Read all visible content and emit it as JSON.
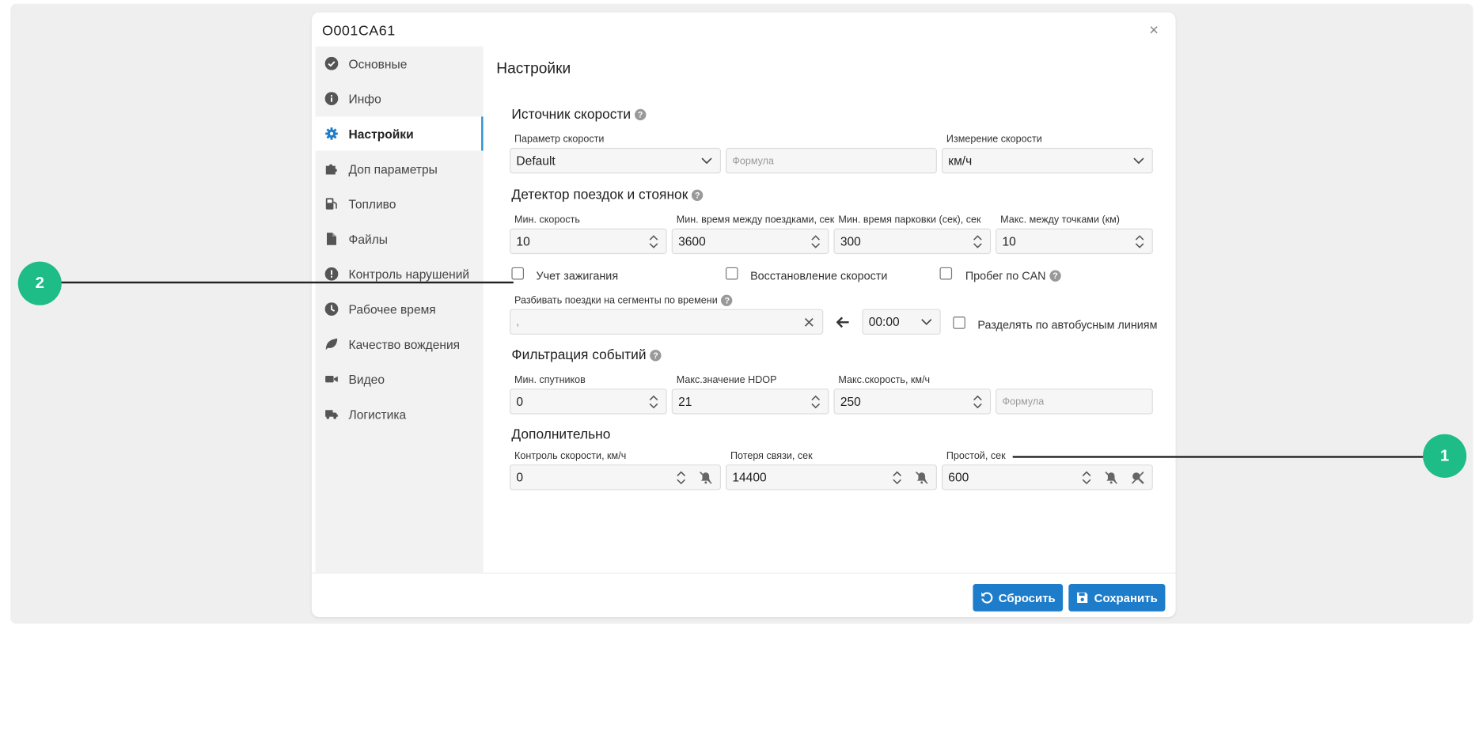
{
  "window": {
    "title": "O001CA61",
    "close": "×"
  },
  "sidebar": {
    "items": [
      {
        "label": "Основные",
        "icon": "check-circle-icon"
      },
      {
        "label": "Инфо",
        "icon": "info-icon"
      },
      {
        "label": "Настройки",
        "icon": "gear-icon",
        "active": true
      },
      {
        "label": "Доп параметры",
        "icon": "puzzle-icon"
      },
      {
        "label": "Топливо",
        "icon": "fuel-pump-icon"
      },
      {
        "label": "Файлы",
        "icon": "file-icon"
      },
      {
        "label": "Контроль нарушений",
        "icon": "warning-icon"
      },
      {
        "label": "Рабочее время",
        "icon": "clock-icon"
      },
      {
        "label": "Качество вождения",
        "icon": "leaf-icon"
      },
      {
        "label": "Видео",
        "icon": "video-icon"
      },
      {
        "label": "Логистика",
        "icon": "truck-icon"
      }
    ]
  },
  "content": {
    "title": "Настройки",
    "speed_source": {
      "heading": "Источник скорости",
      "param_label": "Параметр скорости",
      "param_value": "Default",
      "formula_placeholder": "Формула",
      "unit_label": "Измерение скорости",
      "unit_value": "км/ч"
    },
    "trip_detector": {
      "heading": "Детектор поездок и стоянок",
      "min_speed_label": "Мин. скорость",
      "min_speed": "10",
      "min_time_label": "Мин. время между поездками, сек",
      "min_time": "3600",
      "min_park_label": "Мин. время парковки (сек), сек",
      "min_park": "300",
      "max_dist_label": "Макс. между точками (км)",
      "max_dist": "10",
      "ignition_label": "Учет зажигания",
      "speed_restore_label": "Восстановление скорости",
      "can_mileage_label": "Пробег по CAN",
      "split_label": "Разбивать поездки на сегменты по времени",
      "split_value": ",",
      "time_value": "00:00",
      "bus_lines_label": "Разделять по автобусным линиям"
    },
    "event_filter": {
      "heading": "Фильтрация событий",
      "min_sat_label": "Мин. спутников",
      "min_sat": "0",
      "max_hdop_label": "Макс.значение HDOP",
      "max_hdop": "21",
      "max_speed_label": "Макс.скорость, км/ч",
      "max_speed": "250",
      "formula_placeholder": "Формула"
    },
    "extra": {
      "heading": "Дополнительно",
      "speed_ctrl_label": "Контроль скорости, км/ч",
      "speed_ctrl": "0",
      "conn_loss_label": "Потеря связи, сек",
      "conn_loss": "14400",
      "idle_label": "Простой, сек",
      "idle": "600"
    }
  },
  "footer": {
    "reset_label": "Сбросить",
    "save_label": "Сохранить"
  },
  "callouts": {
    "one": "1",
    "two": "2"
  },
  "colors": {
    "accent": "#1d7dca",
    "callout": "#1ebc86"
  }
}
